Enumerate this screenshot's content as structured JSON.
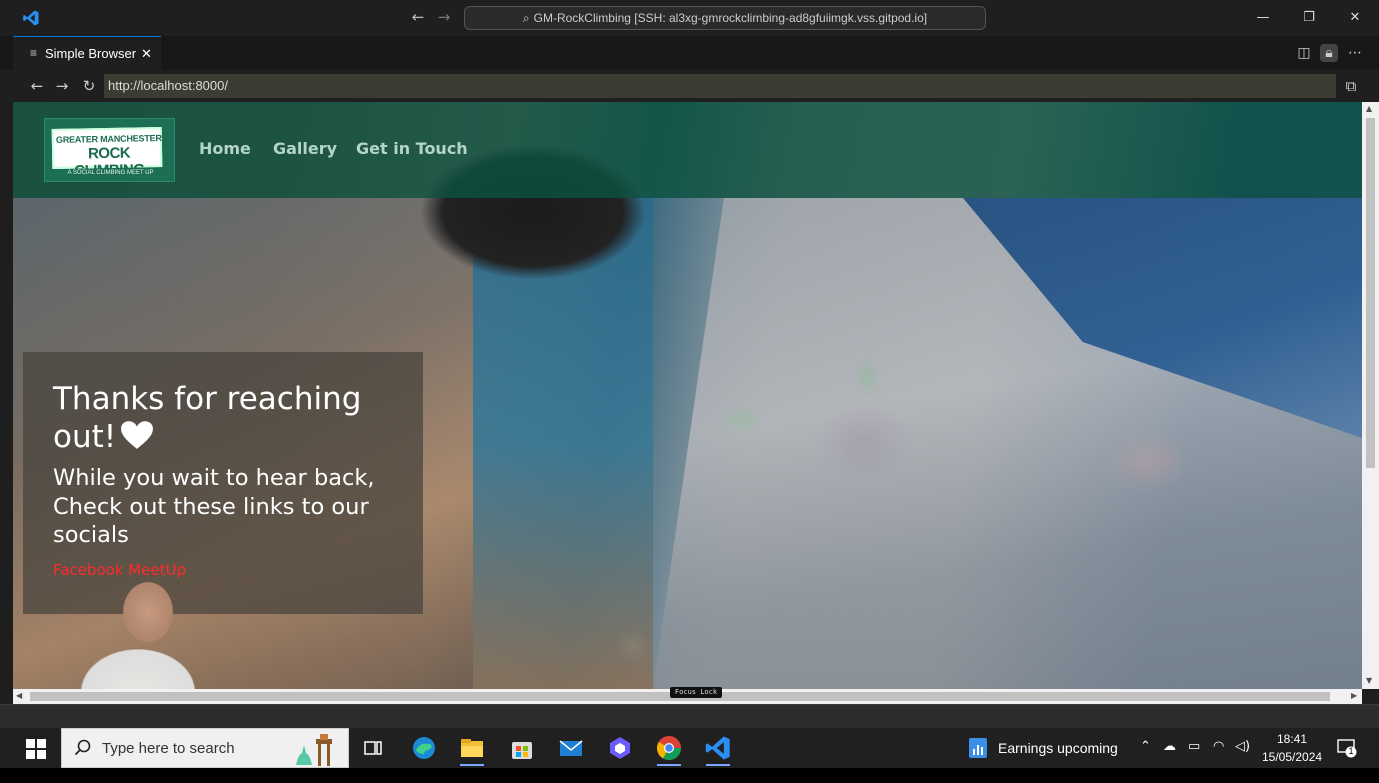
{
  "titlebar": {
    "command_center": "GM-RockClimbing [SSH: al3xg-gmrockclimbing-ad8gfuiimgk.vss.gitpod.io]"
  },
  "tab": {
    "label": "Simple Browser",
    "close": "✕"
  },
  "browser": {
    "url": "http://localhost:8000/"
  },
  "site": {
    "logo_line1": "GREATER MANCHESTER",
    "logo_line2": "ROCK CLIMBING",
    "logo_tagline": "A SOCIAL CLIMBING MEET UP",
    "nav": [
      "Home",
      "Gallery",
      "Get in Touch"
    ],
    "thanks_heading": "Thanks for reaching out!",
    "wait_text": "While you wait to hear back, Check out these links to our socials",
    "facebook_link": "Facebook MeetUp",
    "accent_header": "#0c503e",
    "link_color": "#ff2a2a"
  },
  "overlay": {
    "focus_lock": "Focus Lock"
  },
  "taskbar": {
    "search_placeholder": "Type here to search",
    "earnings": "Earnings upcoming",
    "time": "18:41",
    "date": "15/05/2024",
    "notifications": "1"
  }
}
